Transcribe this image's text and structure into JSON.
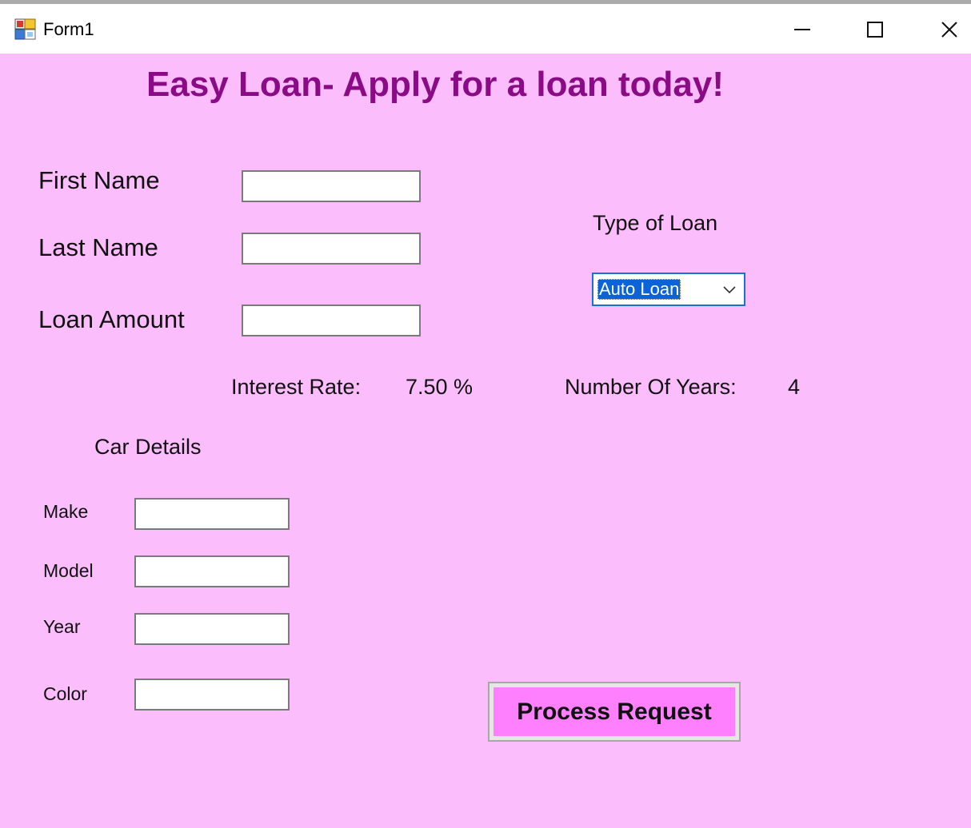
{
  "window": {
    "title": "Form1",
    "icon": "winforms-app-icon",
    "controls": [
      "minimize-icon",
      "maximize-icon",
      "close-icon"
    ]
  },
  "form": {
    "background": "#fcbdfc",
    "heading": "Easy Loan- Apply for a loan today!",
    "heading_color": "#8b0b86"
  },
  "applicant": {
    "first_name_label": "First Name",
    "first_name_value": "",
    "last_name_label": "Last Name",
    "last_name_value": "",
    "loan_amount_label": "Loan Amount",
    "loan_amount_value": ""
  },
  "loan_type": {
    "label": "Type of Loan",
    "selected": "Auto Loan"
  },
  "terms": {
    "interest_label": "Interest Rate:",
    "interest_value": "7.50 %",
    "years_label": "Number Of Years:",
    "years_value": "4"
  },
  "car": {
    "section_label": "Car Details",
    "make_label": "Make",
    "make_value": "",
    "model_label": "Model",
    "model_value": "",
    "year_label": "Year",
    "year_value": "",
    "color_label": "Color",
    "color_value": ""
  },
  "actions": {
    "process_label": "Process Request",
    "process_color": "#ff80ff"
  }
}
